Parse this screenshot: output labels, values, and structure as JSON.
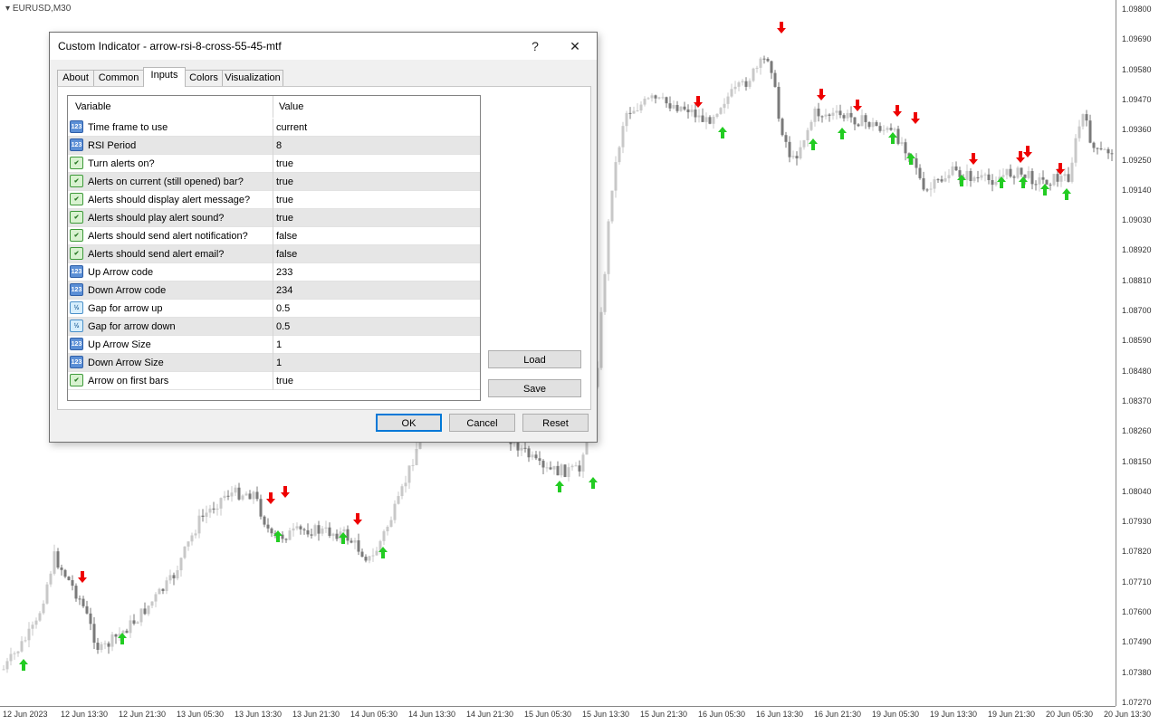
{
  "chart": {
    "symbol": "EURUSD,M30",
    "price_ticks": [
      "1.09800",
      "1.09690",
      "1.09580",
      "1.09470",
      "1.09360",
      "1.09250",
      "1.09140",
      "1.09030",
      "1.08920",
      "1.08810",
      "1.08700",
      "1.08590",
      "1.08480",
      "1.08370",
      "1.08260",
      "1.08150",
      "1.08040",
      "1.07930",
      "1.07820",
      "1.07710",
      "1.07600",
      "1.07490",
      "1.07380",
      "1.07270"
    ],
    "time_ticks": [
      "12 Jun 2023",
      "12 Jun 13:30",
      "12 Jun 21:30",
      "13 Jun 05:30",
      "13 Jun 13:30",
      "13 Jun 21:30",
      "14 Jun 05:30",
      "14 Jun 13:30",
      "14 Jun 21:30",
      "15 Jun 05:30",
      "15 Jun 13:30",
      "15 Jun 21:30",
      "16 Jun 05:30",
      "16 Jun 13:30",
      "16 Jun 21:30",
      "19 Jun 05:30",
      "19 Jun 13:30",
      "19 Jun 21:30",
      "20 Jun 05:30",
      "20 Jun 13:30"
    ],
    "bull_color": "#c8c8c8",
    "bear_color": "#7a7a7a",
    "up_arrow_color": "#22cc22",
    "down_arrow_color": "#ee0000"
  },
  "dialog": {
    "title": "Custom Indicator - arrow-rsi-8-cross-55-45-mtf",
    "help_glyph": "?",
    "close_glyph": "✕",
    "tabs": [
      {
        "label": "About"
      },
      {
        "label": "Common"
      },
      {
        "label": "Inputs"
      },
      {
        "label": "Colors"
      },
      {
        "label": "Visualization"
      }
    ],
    "active_tab": "Inputs",
    "grid": {
      "col_variable": "Variable",
      "col_value": "Value",
      "rows": [
        {
          "type": "int",
          "variable": "Time frame to use",
          "value": "current"
        },
        {
          "type": "int",
          "variable": "RSI Period",
          "value": "8"
        },
        {
          "type": "bool",
          "variable": "Turn alerts on?",
          "value": "true"
        },
        {
          "type": "bool",
          "variable": "Alerts on current (still opened) bar?",
          "value": "true"
        },
        {
          "type": "bool",
          "variable": "Alerts should display alert message?",
          "value": "true"
        },
        {
          "type": "bool",
          "variable": "Alerts should play alert sound?",
          "value": "true"
        },
        {
          "type": "bool",
          "variable": "Alerts should send alert notification?",
          "value": "false"
        },
        {
          "type": "bool",
          "variable": "Alerts should send alert email?",
          "value": "false"
        },
        {
          "type": "int",
          "variable": "Up Arrow code",
          "value": "233"
        },
        {
          "type": "int",
          "variable": "Down Arrow code",
          "value": "234"
        },
        {
          "type": "dbl",
          "variable": "Gap for arrow up",
          "value": "0.5"
        },
        {
          "type": "dbl",
          "variable": "Gap for arrow down",
          "value": "0.5"
        },
        {
          "type": "int",
          "variable": "Up Arrow Size",
          "value": "1"
        },
        {
          "type": "int",
          "variable": "Down Arrow Size",
          "value": "1"
        },
        {
          "type": "bool",
          "variable": "Arrow on first bars",
          "value": "true"
        }
      ]
    },
    "load_label": "Load",
    "save_label": "Save",
    "ok_label": "OK",
    "cancel_label": "Cancel",
    "reset_label": "Reset"
  }
}
